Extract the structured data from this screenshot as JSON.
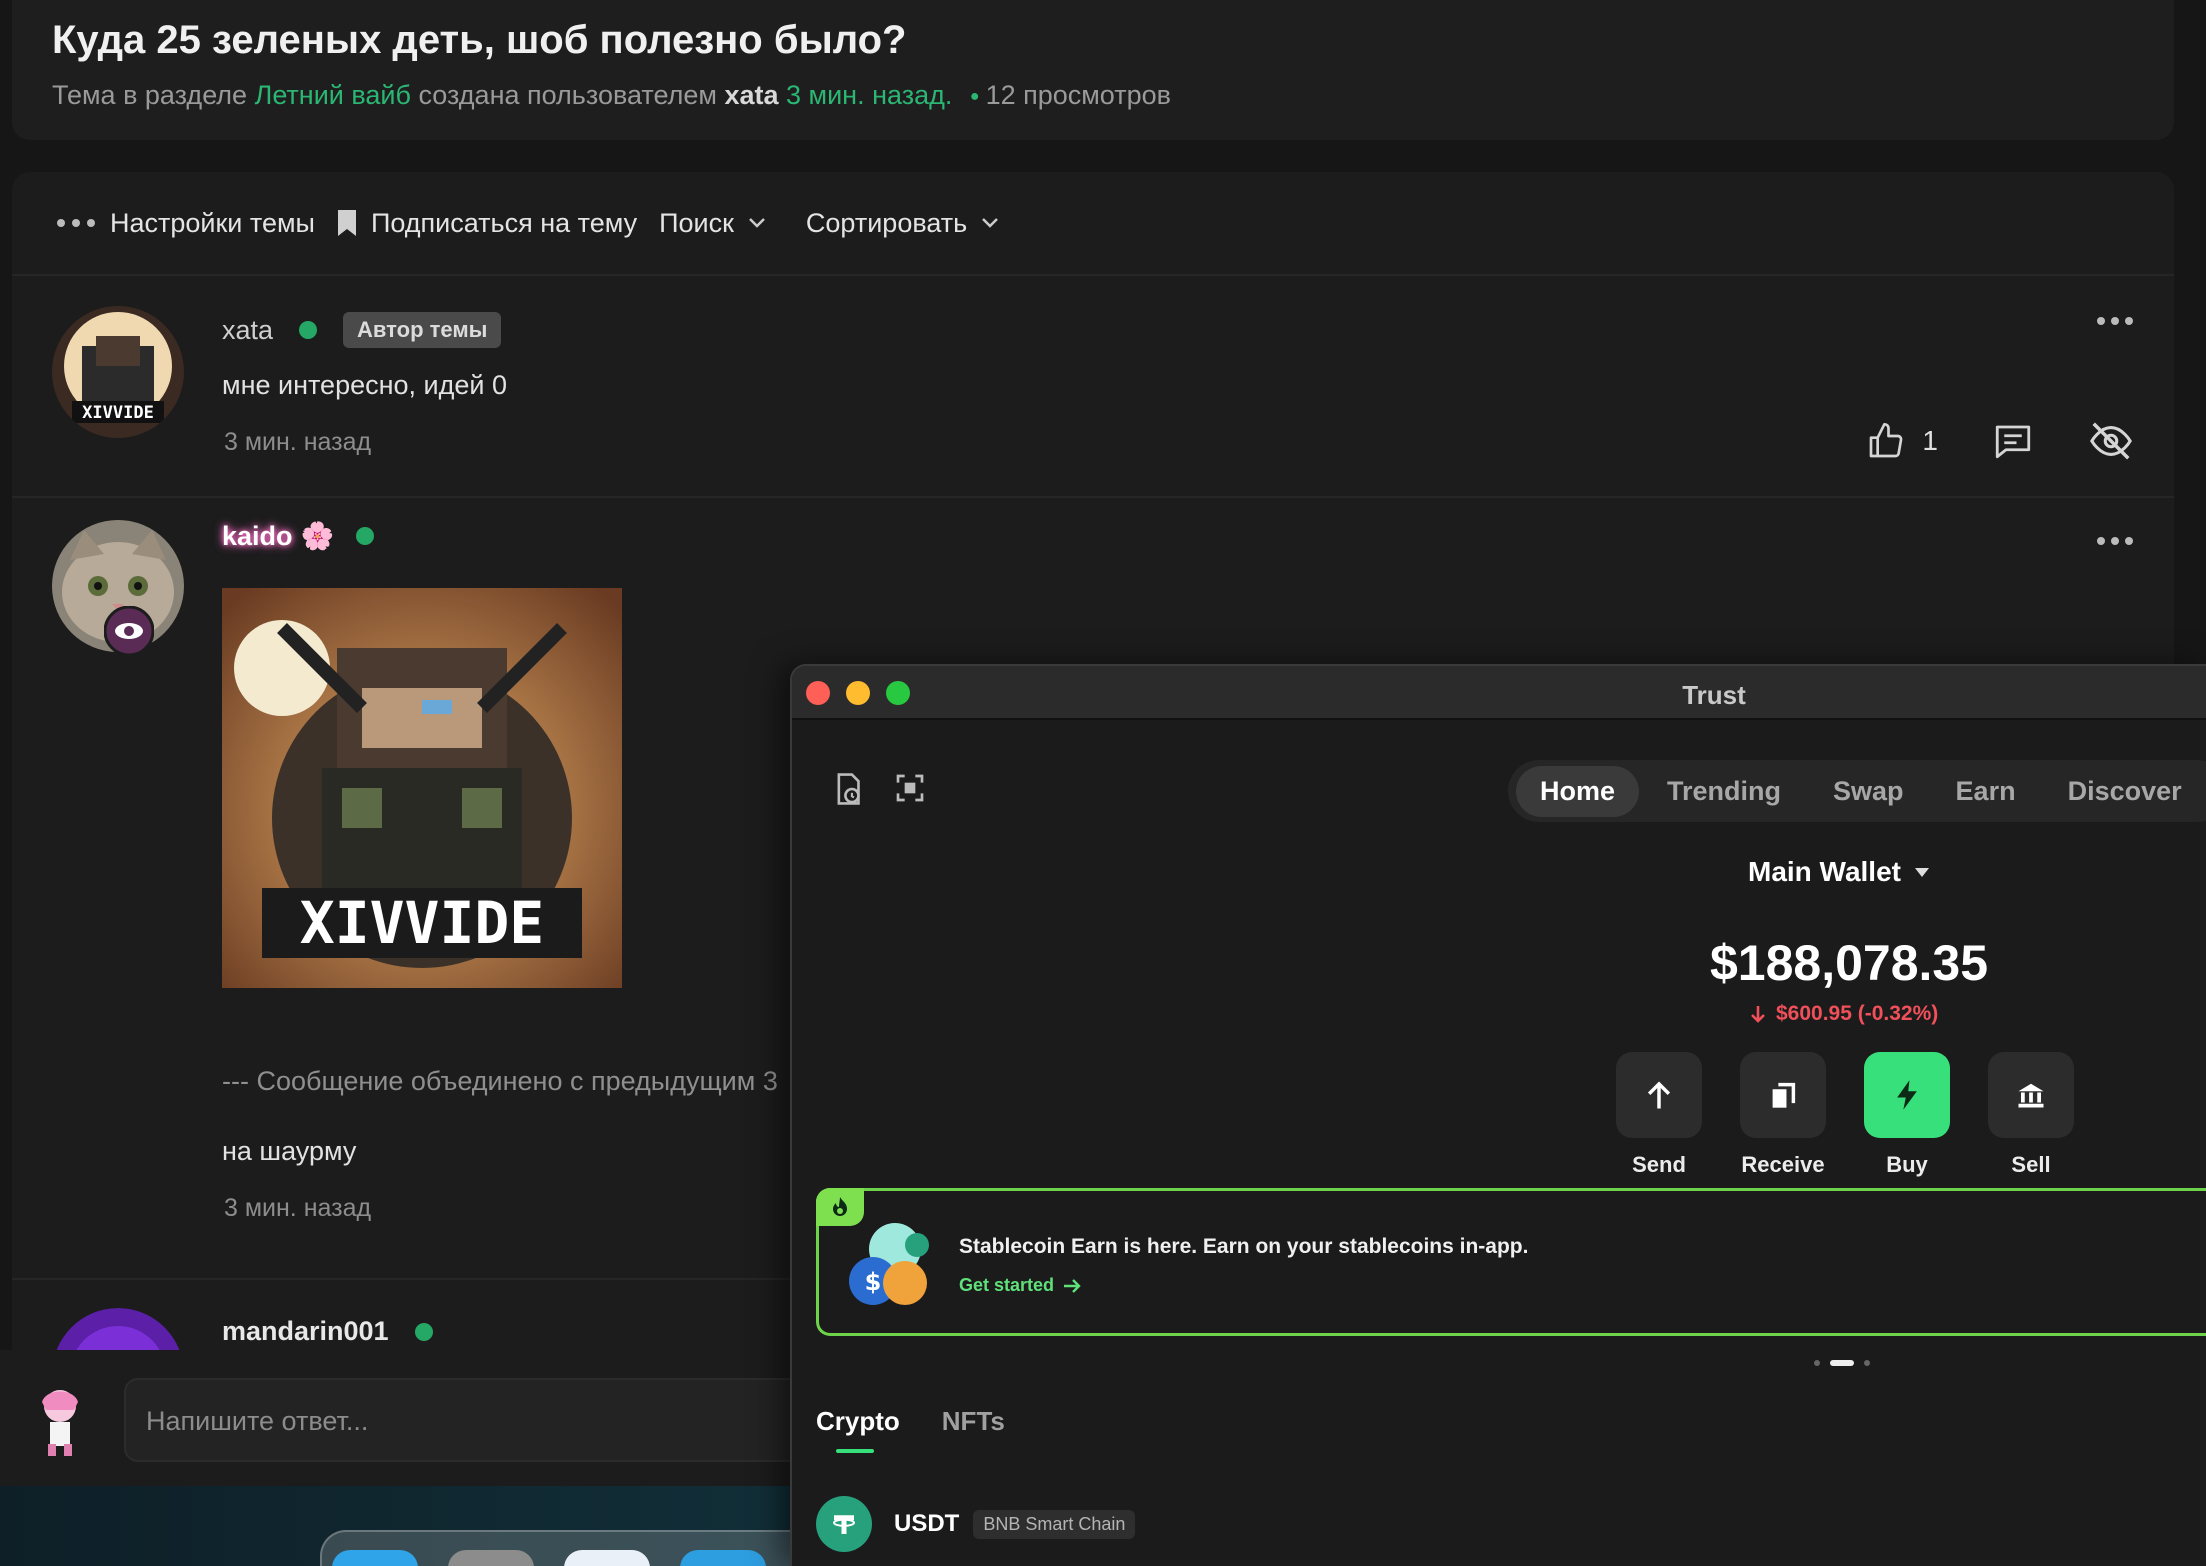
{
  "forum": {
    "title": "Куда 25 зеленых деть, шоб полезно было?",
    "meta": {
      "prefix": "Тема в разделе",
      "section": "Летний вайб",
      "created_by": "создана пользователем",
      "author": "xata",
      "time": "3 мин. назад.",
      "views": "12 просмотров"
    },
    "toolbar": {
      "settings": "Настройки темы",
      "subscribe": "Подписаться на тему",
      "search": "Поиск",
      "sort": "Сортировать"
    },
    "posts": [
      {
        "author": "xata",
        "badge": "Автор темы",
        "text": "мне интересно, идей 0",
        "time": "3 мин. назад",
        "likes": "1"
      },
      {
        "author": "kaido",
        "author_emoji": "🌸",
        "merged": "--- Сообщение объединено с предыдущим 3",
        "text": "на шаурму",
        "time": "3 мин. назад"
      },
      {
        "author": "mandarin001"
      }
    ],
    "reply_placeholder": "Напишите ответ..."
  },
  "trust": {
    "window_title": "Trust",
    "nav": [
      "Home",
      "Trending",
      "Swap",
      "Earn",
      "Discover"
    ],
    "wallet_name": "Main Wallet",
    "balance": "$188,078.35",
    "change": "$600.95 (-0.32%)",
    "actions": [
      "Send",
      "Receive",
      "Buy",
      "Sell"
    ],
    "promo": {
      "text": "Stablecoin Earn is here. Earn on your stablecoins in-app.",
      "link": "Get started"
    },
    "asset_tabs": [
      "Crypto",
      "NFTs"
    ],
    "tokens": [
      {
        "symbol": "USDT",
        "chain": "BNB Smart Chain"
      }
    ]
  },
  "colors": {
    "accent_green": "#38e07b",
    "forum_green": "#2bb673",
    "negative": "#f0505a",
    "promo_border": "#6dd34a"
  },
  "icons": {
    "toolbar": [
      "ellipsis-icon",
      "bookmark-icon",
      "chevron-down-icon"
    ],
    "post_actions": [
      "thumbs-up-icon",
      "comment-icon",
      "eye-off-icon"
    ],
    "wallet_actions": [
      "arrow-up-icon",
      "copy-icon",
      "bolt-icon",
      "bank-icon"
    ]
  }
}
